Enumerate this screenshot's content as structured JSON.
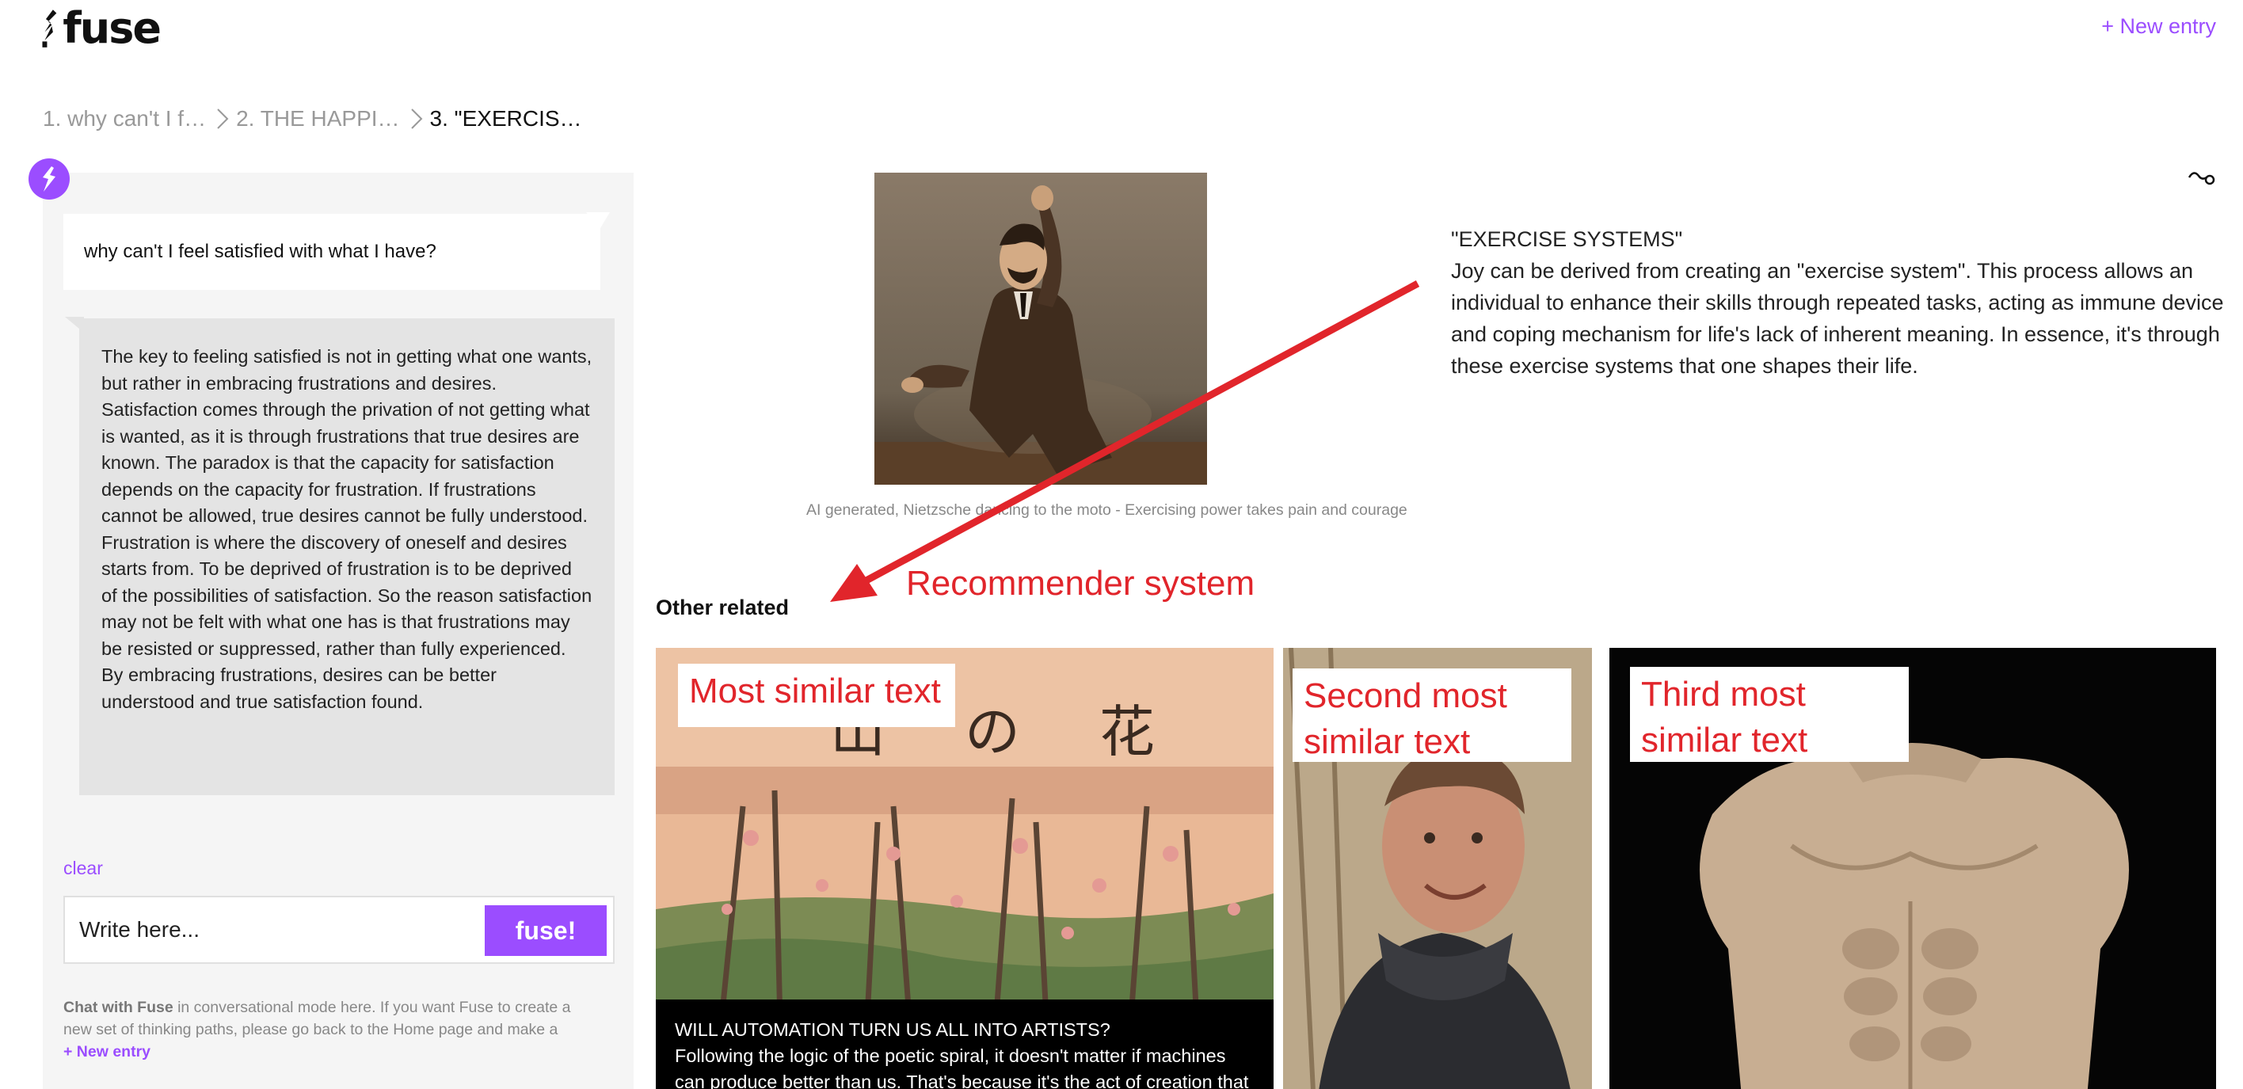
{
  "header": {
    "logo_text": "fuse",
    "new_entry_label": "+ New entry"
  },
  "breadcrumb": [
    {
      "label": "1. why can't I f…"
    },
    {
      "label": "2. THE HAPPI…"
    },
    {
      "label": "3. \"EXERCIS…"
    }
  ],
  "chat": {
    "question": "why can't I feel satisfied with what I have?",
    "answer": "The key to feeling satisfied is not in getting what one wants, but rather in embracing frustrations and desires. Satisfaction comes through the privation of not getting what is wanted, as it is through frustrations that true desires are known. The paradox is that the capacity for satisfaction depends on the capacity for frustration. If frustrations cannot be allowed, true desires cannot be fully understood. Frustration is where the discovery of oneself and desires starts from. To be deprived of frustration is to be deprived of the possibilities of satisfaction. So the reason satisfaction may not be felt with what one has is that frustrations may be resisted or suppressed, rather than fully experienced. By embracing frustrations, desires can be better understood and true satisfaction found.",
    "clear_label": "clear",
    "input_placeholder": "Write here...",
    "submit_label": "fuse!",
    "note_bold": "Chat with Fuse",
    "note_text": " in conversational mode here. If you want Fuse to create a new set of thinking paths, please go back to the Home page and make a",
    "note_link": "+ New entry"
  },
  "entry": {
    "image_caption": "AI generated, Nietzsche dancing to the moto - Exercising power takes pain and courage",
    "title": "\"EXERCISE SYSTEMS\"",
    "body": "Joy can be derived from creating an \"exercise system\". This process allows an individual to enhance their skills through repeated tasks, acting as immune device and coping mechanism for life's lack of inherent meaning. In essence, it's through these exercise systems that one shapes their life."
  },
  "annotation": {
    "label": "Recommender system",
    "color": "#e1252b"
  },
  "related": {
    "heading": "Other related",
    "cards": [
      {
        "label": "Most similar text",
        "caption_title": "WILL AUTOMATION TURN US ALL INTO ARTISTS?",
        "caption_body": "Following the logic of the poetic spiral, it doesn't matter if machines can produce better than us. That's because it's the act of creation that",
        "image": "japanese-print-with-blossom-trees"
      },
      {
        "label": "Second most similar text",
        "image": "smiling-young-man-in-hoodie"
      },
      {
        "label": "Third most similar text",
        "image": "classical-marble-torso-sculpture"
      }
    ]
  },
  "colors": {
    "brand_purple": "#9b4dff",
    "panel_bg": "#f5f5f5",
    "answer_bg": "#e4e4e4"
  },
  "icons": [
    "fuse-logo-icon",
    "chevron-right-icon",
    "chat-bolt-icon",
    "link-icon"
  ]
}
